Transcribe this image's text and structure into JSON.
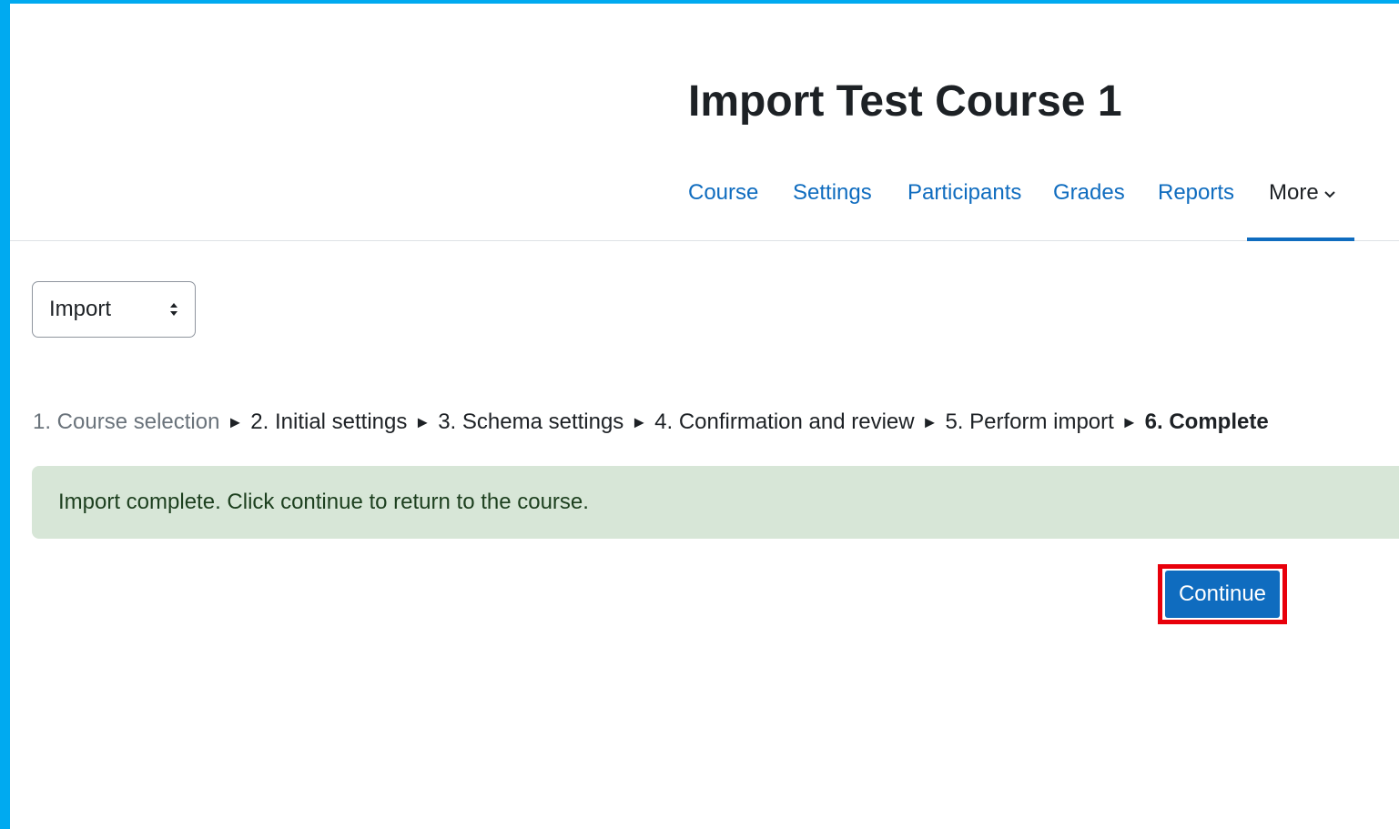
{
  "page": {
    "title": "Import Test Course 1"
  },
  "nav": {
    "items": [
      {
        "label": "Course"
      },
      {
        "label": "Settings"
      },
      {
        "label": "Participants"
      },
      {
        "label": "Grades"
      },
      {
        "label": "Reports"
      },
      {
        "label": "More"
      }
    ],
    "active": "More"
  },
  "action_select": {
    "value": "Import"
  },
  "steps": {
    "items": [
      "1. Course selection",
      "2. Initial settings",
      "3. Schema settings",
      "4. Confirmation and review",
      "5. Perform import",
      "6. Complete"
    ],
    "current_index": 5
  },
  "alert": {
    "message": "Import complete. Click continue to return to the course."
  },
  "continue_button": {
    "label": "Continue"
  },
  "colors": {
    "frame": "#00aaf0",
    "link": "#0f6cbf",
    "alert_bg": "#d7e6d7",
    "highlight": "#e8000b"
  },
  "icons": {
    "select": "up-down-arrows-icon",
    "more": "chevron-down-icon",
    "step_separator": "arrow-right-icon"
  }
}
